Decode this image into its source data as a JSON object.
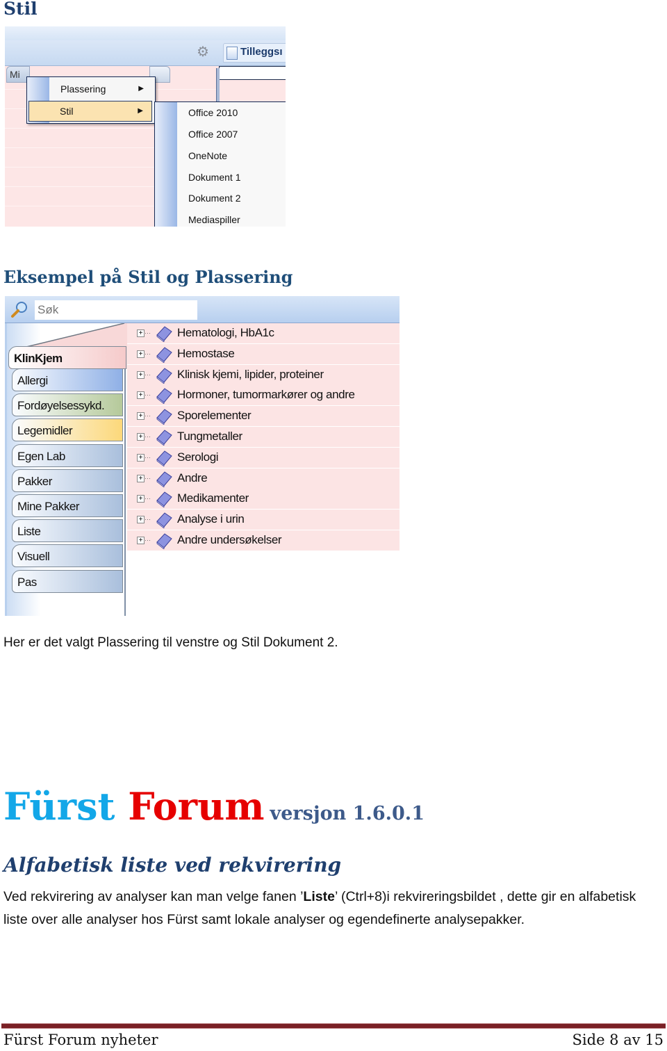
{
  "section1": {
    "heading": "Stil",
    "screenshot": {
      "toolbar": {
        "gear_icon": "gear-icon",
        "tillegg_label": "Tilleggsı",
        "left_tab_label": "Mi"
      },
      "menu": {
        "items": [
          {
            "label": "Plassering",
            "has_submenu": true,
            "selected": false
          },
          {
            "label": "Stil",
            "has_submenu": true,
            "selected": true
          }
        ]
      },
      "submenu": {
        "items": [
          "Office 2010",
          "Office 2007",
          "OneNote",
          "Dokument 1",
          "Dokument 2",
          "Mediaspiller"
        ]
      }
    }
  },
  "section2": {
    "heading": "Eksempel på Stil og Plassering",
    "screenshot": {
      "search": {
        "placeholder": "Søk",
        "icon": "magnifier-icon"
      },
      "tabs": [
        {
          "label": "KlinKjem",
          "active": true,
          "color": "#f5caca"
        },
        {
          "label": "Allergi",
          "active": false,
          "color": "#8fb0e6"
        },
        {
          "label": "Fordøyelsessykd.",
          "active": false,
          "color": "#b5c99a"
        },
        {
          "label": "Legemidler",
          "active": false,
          "color": "#fcd87a"
        },
        {
          "label": "Egen Lab",
          "active": false,
          "color": "#a9bfdc"
        },
        {
          "label": "Pakker",
          "active": false,
          "color": "#a9bfdc"
        },
        {
          "label": "Mine Pakker",
          "active": false,
          "color": "#a9bfdc"
        },
        {
          "label": "Liste",
          "active": false,
          "color": "#a9bfdc"
        },
        {
          "label": "Visuell",
          "active": false,
          "color": "#a9bfdc"
        },
        {
          "label": "Pas",
          "active": false,
          "color": "#a9bfdc"
        }
      ],
      "tree": [
        "Hematologi, HbA1c",
        "Hemostase",
        "Klinisk kjemi, lipider, proteiner",
        "Hormoner, tumormarkører og andre",
        "Sporelementer",
        "Tungmetaller",
        "Serologi",
        "Andre",
        "Medikamenter",
        "Analyse i urin",
        "Andre undersøkelser"
      ]
    },
    "caption": "Her er det valgt Plassering til venstre og Stil Dokument 2."
  },
  "brand": {
    "word1": "Fürst",
    "word2": "Forum",
    "version": "versjon 1.6.0.1",
    "colors": {
      "word1": "#13a7e8",
      "word2": "#e60000",
      "version": "#3d5a8a"
    }
  },
  "section3": {
    "heading": "Alfabetisk liste ved rekvirering",
    "para_before": "Ved rekvirering av analyser kan man velge fanen ’",
    "para_bold": "Liste",
    "para_after": "’  (Ctrl+8)i rekvireringsbildet , dette gir en alfabetisk liste over alle analyser hos Fürst samt lokale analyser og egendefinerte analysepakker."
  },
  "footer": {
    "left": "Fürst Forum nyheter",
    "right": "Side 8 av 15"
  }
}
